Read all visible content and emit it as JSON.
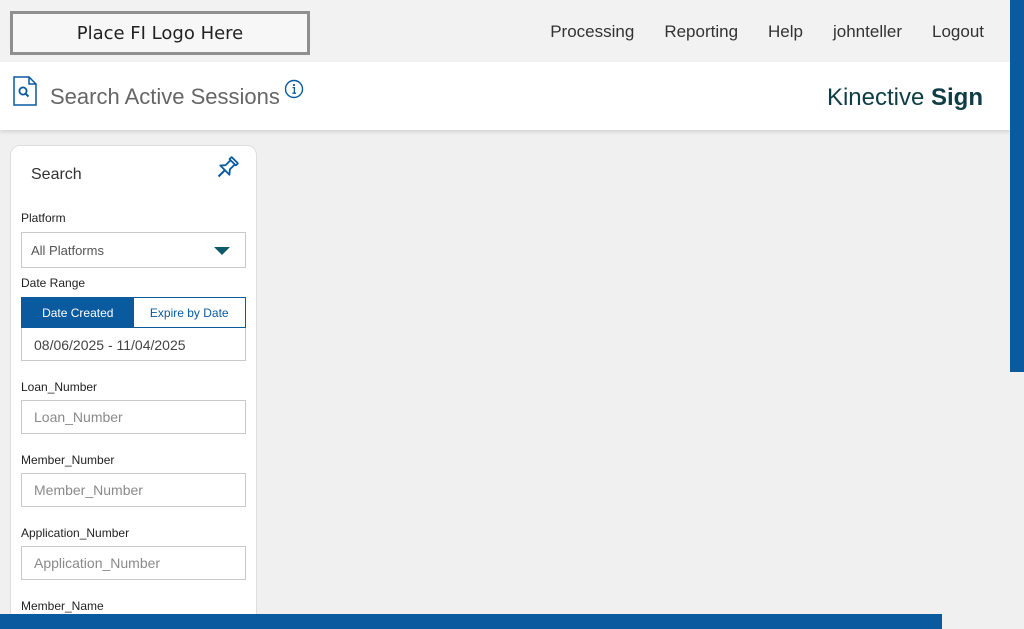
{
  "header": {
    "logo_text": "Place FI Logo Here",
    "nav": [
      "Processing",
      "Reporting",
      "Help",
      "johnteller",
      "Logout"
    ]
  },
  "titlebar": {
    "title": "Search Active Sessions",
    "brand_light": "Kinective",
    "brand_bold": "Sign"
  },
  "search_panel": {
    "title": "Search",
    "platform_label": "Platform",
    "platform_value": "All Platforms",
    "date_range_label": "Date Range",
    "date_created_label": "Date Created",
    "expire_by_date_label": "Expire by Date",
    "date_range_value": "08/06/2025 - 11/04/2025",
    "loan_number_label": "Loan_Number",
    "loan_number_placeholder": "Loan_Number",
    "member_number_label": "Member_Number",
    "member_number_placeholder": "Member_Number",
    "application_number_label": "Application_Number",
    "application_number_placeholder": "Application_Number",
    "member_name_label": "Member_Name"
  },
  "colors": {
    "accent": "#0a5aa0",
    "brand_text": "#0e3d45",
    "background": "#f0f0f0"
  },
  "icons": {
    "page_icon": "document-search-icon",
    "info": "info-icon",
    "pin": "pushpin-icon",
    "dropdown": "caret-down-icon"
  }
}
